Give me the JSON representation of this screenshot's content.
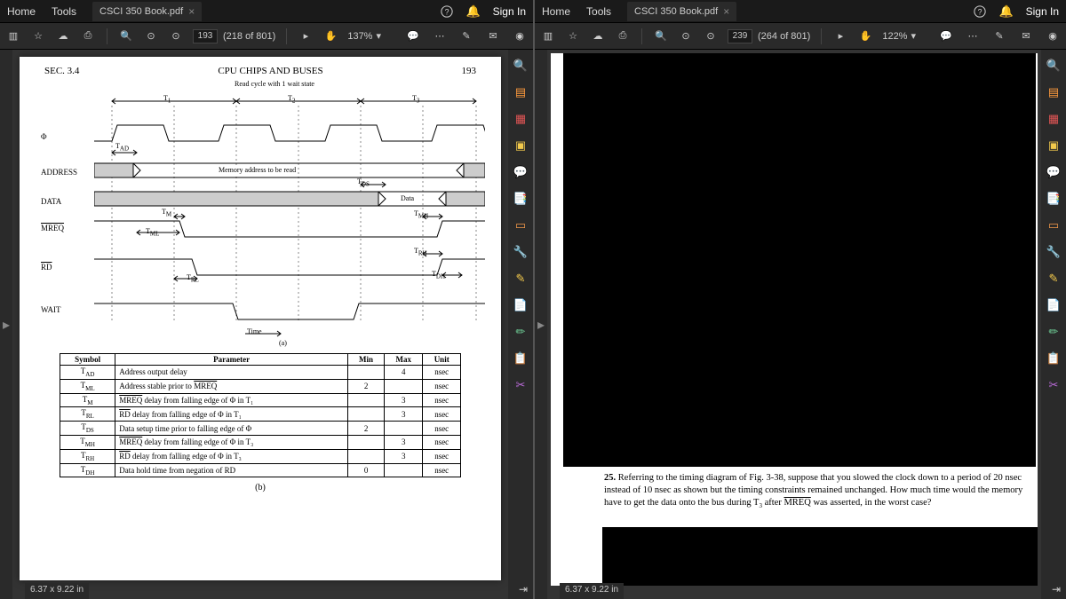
{
  "tabs": {
    "home": "Home",
    "tools": "Tools"
  },
  "file": {
    "name": "CSCI 350 Book.pdf"
  },
  "auth": {
    "signin": "Sign In"
  },
  "left": {
    "page_current": "193",
    "page_total": "(218 of 801)",
    "zoom": "137%",
    "dims": "6.37 x 9.22 in",
    "doc": {
      "section": "SEC. 3.4",
      "chapter_title": "CPU CHIPS AND BUSES",
      "page_num": "193",
      "diagram_title": "Read cycle with 1 wait state",
      "t1": "T",
      "t1s": "1",
      "t2": "T",
      "t2s": "2",
      "t3": "T",
      "t3s": "3",
      "sig_phi": "Φ",
      "sig_addr": "ADDRESS",
      "sig_data": "DATA",
      "sig_mreq": "MREQ",
      "sig_rd": "RD",
      "sig_wait": "WAIT",
      "addr_text": "Memory address to be read",
      "data_text": "Data",
      "tad": "T",
      "tads": "AD",
      "tm": "T",
      "tms": "M",
      "tml": "T",
      "tmls": "ML",
      "trl": "T",
      "trls": "RL",
      "tds": "T",
      "tdss": "DS",
      "tmh": "T",
      "tmhs": "MH",
      "trh": "T",
      "trhs": "RH",
      "tdh": "T",
      "tdhs": "DH",
      "time_lbl": "Time",
      "sub_a": "(a)",
      "sub_b": "(b)",
      "table": {
        "headers": {
          "sym": "Symbol",
          "param": "Parameter",
          "min": "Min",
          "max": "Max",
          "unit": "Unit"
        },
        "rows": [
          {
            "sym": "T",
            "sub": "AD",
            "param": "Address output delay",
            "min": "",
            "max": "4",
            "unit": "nsec"
          },
          {
            "sym": "T",
            "sub": "ML",
            "param": "Address stable prior to MREQ",
            "ov": true,
            "min": "2",
            "max": "",
            "unit": "nsec"
          },
          {
            "sym": "T",
            "sub": "M",
            "param": "MREQ delay from falling edge of Φ in T₁",
            "ov": true,
            "min": "",
            "max": "3",
            "unit": "nsec"
          },
          {
            "sym": "T",
            "sub": "RL",
            "param": "RD delay from falling edge of Φ in T₁",
            "ov": true,
            "min": "",
            "max": "3",
            "unit": "nsec"
          },
          {
            "sym": "T",
            "sub": "DS",
            "param": "Data setup time prior to falling edge of Φ",
            "min": "2",
            "max": "",
            "unit": "nsec"
          },
          {
            "sym": "T",
            "sub": "MH",
            "param": "MREQ delay from falling edge of Φ in T₃",
            "ov": true,
            "min": "",
            "max": "3",
            "unit": "nsec"
          },
          {
            "sym": "T",
            "sub": "RH",
            "param": "RD delay from falling edge of Φ in T₃",
            "ov": true,
            "min": "",
            "max": "3",
            "unit": "nsec"
          },
          {
            "sym": "T",
            "sub": "DH",
            "param": "Data hold time from negation of RD",
            "ov": true,
            "min": "0",
            "max": "",
            "unit": "nsec"
          }
        ]
      }
    }
  },
  "right": {
    "page_current": "239",
    "page_total": "(264 of 801)",
    "zoom": "122%",
    "dims": "6.37 x 9.22 in",
    "q25": {
      "num": "25.",
      "text": "Referring to the timing diagram of Fig. 3-38, suppose that you slowed the clock down to a period of 20 nsec instead of 10 nsec as shown but the timing constraints remained unchanged.  How much time would the memory have to get the data onto the bus during T₃ after MREQ was asserted, in the worst case?"
    }
  },
  "rail_colors": [
    "#5bb0d8",
    "#ff9b3d",
    "#e05555",
    "#f2c94c",
    "#5bb0d8",
    "#7fd47f",
    "#f2994a",
    "#e05555",
    "#f2c94c",
    "#e05555",
    "#6fcf97",
    "#f2c94c",
    "#bb6bd9"
  ]
}
